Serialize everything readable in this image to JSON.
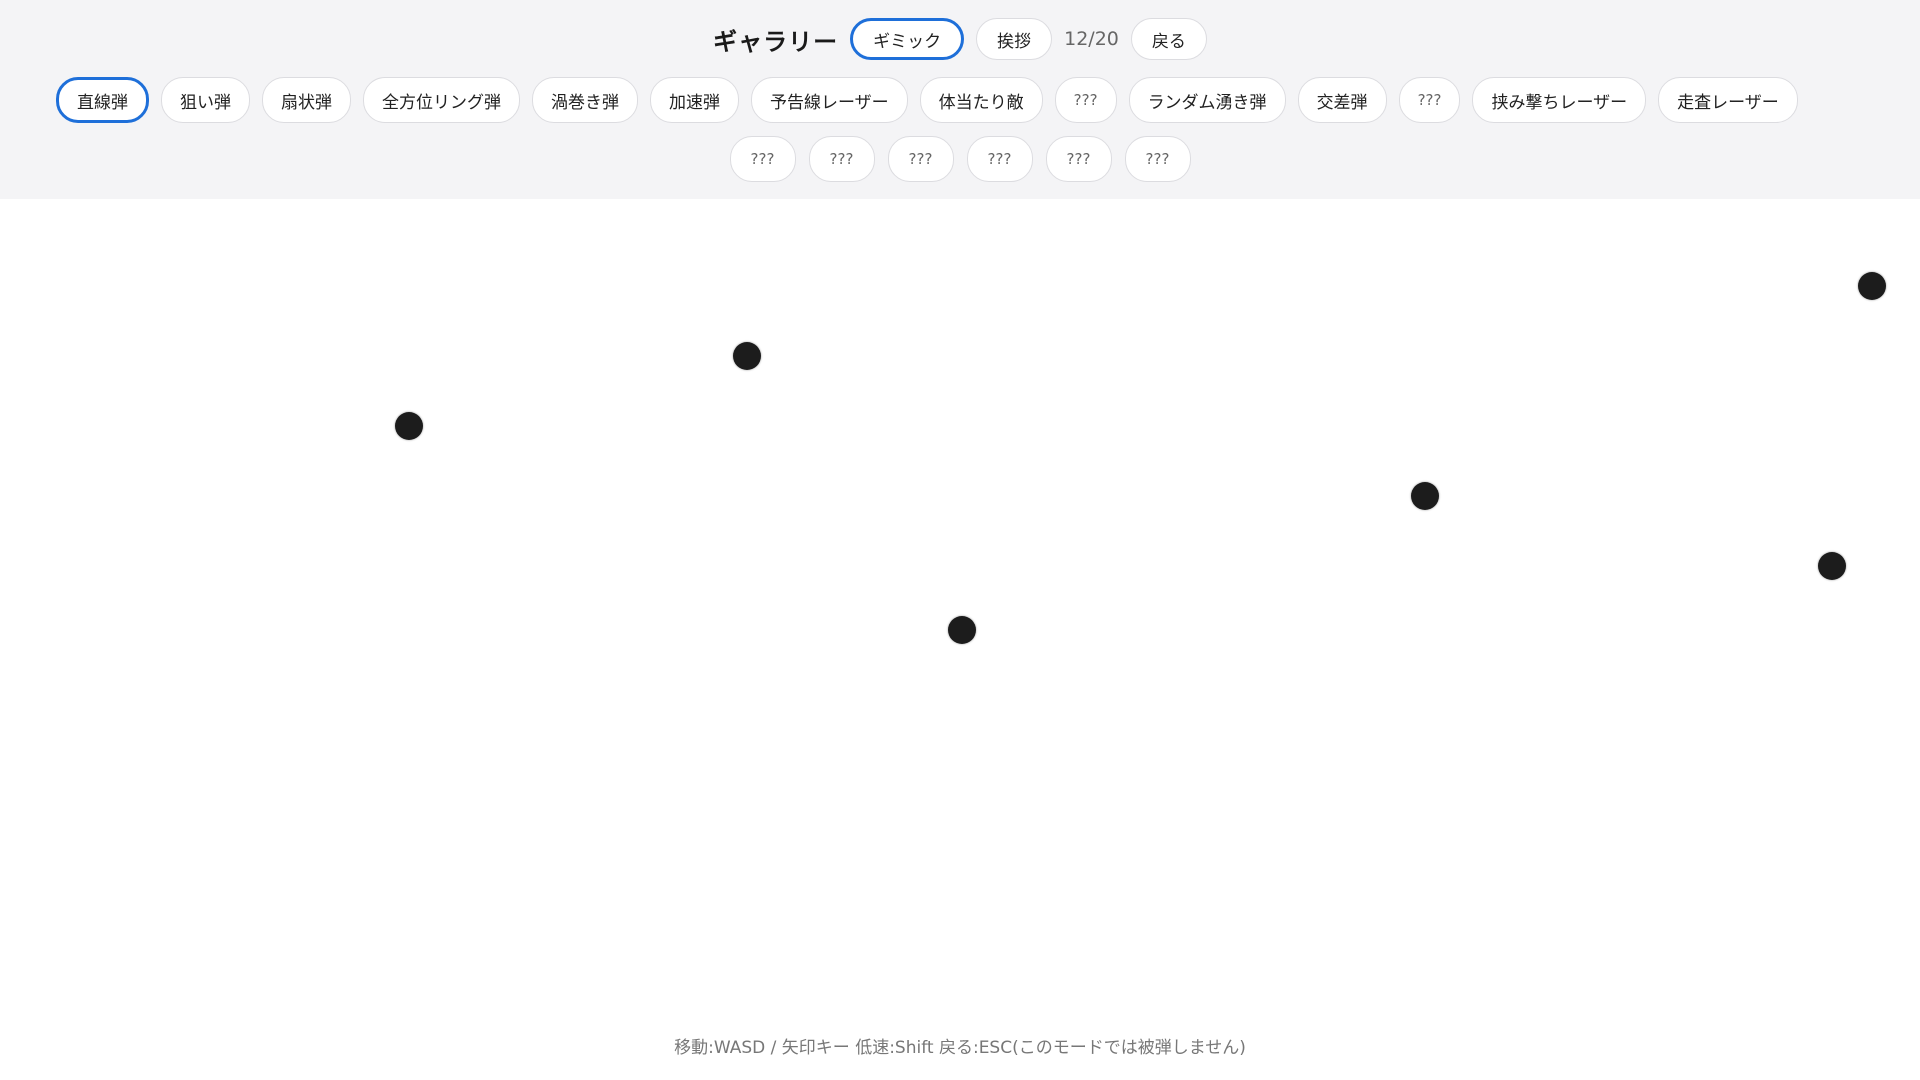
{
  "header": {
    "title": "ギャラリー",
    "mode_tabs": [
      {
        "label": "ギミック",
        "active": true
      },
      {
        "label": "挨拶",
        "active": false
      }
    ],
    "counter": "12/20",
    "back_label": "戻る"
  },
  "categories": [
    {
      "label": "直線弾",
      "active": true
    },
    {
      "label": "狙い弾"
    },
    {
      "label": "扇状弾"
    },
    {
      "label": "全方位リング弾"
    },
    {
      "label": "渦巻き弾"
    },
    {
      "label": "加速弾"
    },
    {
      "label": "予告線レーザー"
    },
    {
      "label": "体当たり敵"
    },
    {
      "label": "???",
      "locked": true
    },
    {
      "label": "ランダム湧き弾"
    },
    {
      "label": "交差弾"
    },
    {
      "label": "???",
      "locked": true
    },
    {
      "label": "挟み撃ちレーザー"
    },
    {
      "label": "走査レーザー"
    }
  ],
  "categories_row2": [
    {
      "label": "???",
      "locked": true
    },
    {
      "label": "???",
      "locked": true
    },
    {
      "label": "???",
      "locked": true
    },
    {
      "label": "???",
      "locked": true
    },
    {
      "label": "???",
      "locked": true
    },
    {
      "label": "???",
      "locked": true
    }
  ],
  "footer": {
    "help_text": "移動:WASD / 矢印キー 低速:Shift 戻る:ESC(このモードでは被弾しません)"
  },
  "colors": {
    "accent": "#1e6fd9",
    "header_bg": "#f4f4f6",
    "bullet": "#1c1c1c"
  }
}
